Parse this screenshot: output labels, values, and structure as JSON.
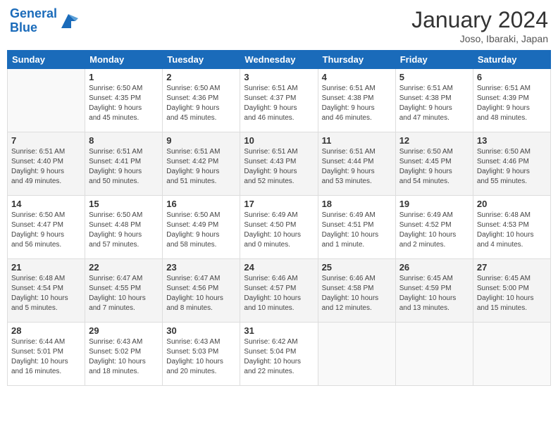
{
  "header": {
    "logo_line1": "General",
    "logo_line2": "Blue",
    "month_title": "January 2024",
    "location": "Joso, Ibaraki, Japan"
  },
  "weekdays": [
    "Sunday",
    "Monday",
    "Tuesday",
    "Wednesday",
    "Thursday",
    "Friday",
    "Saturday"
  ],
  "weeks": [
    [
      {
        "day": "",
        "info": ""
      },
      {
        "day": "1",
        "info": "Sunrise: 6:50 AM\nSunset: 4:35 PM\nDaylight: 9 hours\nand 45 minutes."
      },
      {
        "day": "2",
        "info": "Sunrise: 6:50 AM\nSunset: 4:36 PM\nDaylight: 9 hours\nand 45 minutes."
      },
      {
        "day": "3",
        "info": "Sunrise: 6:51 AM\nSunset: 4:37 PM\nDaylight: 9 hours\nand 46 minutes."
      },
      {
        "day": "4",
        "info": "Sunrise: 6:51 AM\nSunset: 4:38 PM\nDaylight: 9 hours\nand 46 minutes."
      },
      {
        "day": "5",
        "info": "Sunrise: 6:51 AM\nSunset: 4:38 PM\nDaylight: 9 hours\nand 47 minutes."
      },
      {
        "day": "6",
        "info": "Sunrise: 6:51 AM\nSunset: 4:39 PM\nDaylight: 9 hours\nand 48 minutes."
      }
    ],
    [
      {
        "day": "7",
        "info": "Sunrise: 6:51 AM\nSunset: 4:40 PM\nDaylight: 9 hours\nand 49 minutes."
      },
      {
        "day": "8",
        "info": "Sunrise: 6:51 AM\nSunset: 4:41 PM\nDaylight: 9 hours\nand 50 minutes."
      },
      {
        "day": "9",
        "info": "Sunrise: 6:51 AM\nSunset: 4:42 PM\nDaylight: 9 hours\nand 51 minutes."
      },
      {
        "day": "10",
        "info": "Sunrise: 6:51 AM\nSunset: 4:43 PM\nDaylight: 9 hours\nand 52 minutes."
      },
      {
        "day": "11",
        "info": "Sunrise: 6:51 AM\nSunset: 4:44 PM\nDaylight: 9 hours\nand 53 minutes."
      },
      {
        "day": "12",
        "info": "Sunrise: 6:50 AM\nSunset: 4:45 PM\nDaylight: 9 hours\nand 54 minutes."
      },
      {
        "day": "13",
        "info": "Sunrise: 6:50 AM\nSunset: 4:46 PM\nDaylight: 9 hours\nand 55 minutes."
      }
    ],
    [
      {
        "day": "14",
        "info": "Sunrise: 6:50 AM\nSunset: 4:47 PM\nDaylight: 9 hours\nand 56 minutes."
      },
      {
        "day": "15",
        "info": "Sunrise: 6:50 AM\nSunset: 4:48 PM\nDaylight: 9 hours\nand 57 minutes."
      },
      {
        "day": "16",
        "info": "Sunrise: 6:50 AM\nSunset: 4:49 PM\nDaylight: 9 hours\nand 58 minutes."
      },
      {
        "day": "17",
        "info": "Sunrise: 6:49 AM\nSunset: 4:50 PM\nDaylight: 10 hours\nand 0 minutes."
      },
      {
        "day": "18",
        "info": "Sunrise: 6:49 AM\nSunset: 4:51 PM\nDaylight: 10 hours\nand 1 minute."
      },
      {
        "day": "19",
        "info": "Sunrise: 6:49 AM\nSunset: 4:52 PM\nDaylight: 10 hours\nand 2 minutes."
      },
      {
        "day": "20",
        "info": "Sunrise: 6:48 AM\nSunset: 4:53 PM\nDaylight: 10 hours\nand 4 minutes."
      }
    ],
    [
      {
        "day": "21",
        "info": "Sunrise: 6:48 AM\nSunset: 4:54 PM\nDaylight: 10 hours\nand 5 minutes."
      },
      {
        "day": "22",
        "info": "Sunrise: 6:47 AM\nSunset: 4:55 PM\nDaylight: 10 hours\nand 7 minutes."
      },
      {
        "day": "23",
        "info": "Sunrise: 6:47 AM\nSunset: 4:56 PM\nDaylight: 10 hours\nand 8 minutes."
      },
      {
        "day": "24",
        "info": "Sunrise: 6:46 AM\nSunset: 4:57 PM\nDaylight: 10 hours\nand 10 minutes."
      },
      {
        "day": "25",
        "info": "Sunrise: 6:46 AM\nSunset: 4:58 PM\nDaylight: 10 hours\nand 12 minutes."
      },
      {
        "day": "26",
        "info": "Sunrise: 6:45 AM\nSunset: 4:59 PM\nDaylight: 10 hours\nand 13 minutes."
      },
      {
        "day": "27",
        "info": "Sunrise: 6:45 AM\nSunset: 5:00 PM\nDaylight: 10 hours\nand 15 minutes."
      }
    ],
    [
      {
        "day": "28",
        "info": "Sunrise: 6:44 AM\nSunset: 5:01 PM\nDaylight: 10 hours\nand 16 minutes."
      },
      {
        "day": "29",
        "info": "Sunrise: 6:43 AM\nSunset: 5:02 PM\nDaylight: 10 hours\nand 18 minutes."
      },
      {
        "day": "30",
        "info": "Sunrise: 6:43 AM\nSunset: 5:03 PM\nDaylight: 10 hours\nand 20 minutes."
      },
      {
        "day": "31",
        "info": "Sunrise: 6:42 AM\nSunset: 5:04 PM\nDaylight: 10 hours\nand 22 minutes."
      },
      {
        "day": "",
        "info": ""
      },
      {
        "day": "",
        "info": ""
      },
      {
        "day": "",
        "info": ""
      }
    ]
  ]
}
